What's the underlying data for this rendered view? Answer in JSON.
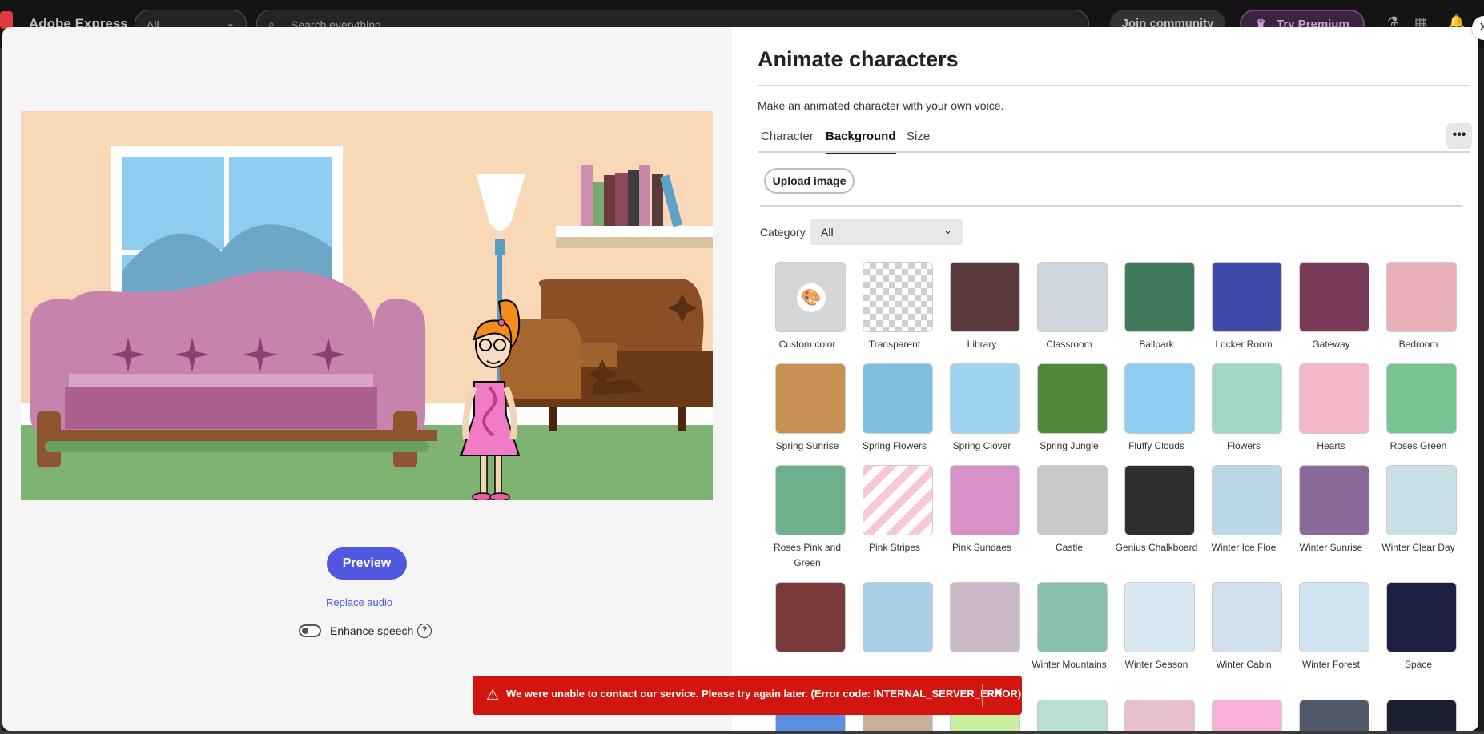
{
  "app": {
    "brand": "Adobe Express",
    "scope_value": "All",
    "search_placeholder": "Search everything",
    "join_label": "Join community",
    "premium_label": "Try Premium"
  },
  "panel": {
    "title": "Animate characters",
    "subtitle": "Make an animated character with your own voice.",
    "tabs": [
      {
        "label": "Character",
        "active": false
      },
      {
        "label": "Background",
        "active": true
      },
      {
        "label": "Size",
        "active": false
      }
    ],
    "more_label": "•••",
    "upload_label": "Upload image",
    "category_label": "Category",
    "category_value": "All",
    "tiles": [
      {
        "label": "Custom color"
      },
      {
        "label": "Transparent"
      },
      {
        "label": "Library"
      },
      {
        "label": "Classroom"
      },
      {
        "label": "Ballpark"
      },
      {
        "label": "Locker Room"
      },
      {
        "label": "Gateway"
      },
      {
        "label": "Bedroom"
      },
      {
        "label": "Spring Sunrise"
      },
      {
        "label": "Spring Flowers"
      },
      {
        "label": "Spring Clover"
      },
      {
        "label": "Spring Jungle"
      },
      {
        "label": "Fluffy Clouds"
      },
      {
        "label": "Flowers"
      },
      {
        "label": "Hearts"
      },
      {
        "label": "Roses Green"
      },
      {
        "label": "Roses Pink and Green"
      },
      {
        "label": "Pink Stripes"
      },
      {
        "label": "Pink Sundaes"
      },
      {
        "label": "Castle"
      },
      {
        "label": "Genius Chalkboard"
      },
      {
        "label": "Winter Ice Floe"
      },
      {
        "label": "Winter Sunrise"
      },
      {
        "label": "Winter Clear Day"
      },
      {
        "label": ""
      },
      {
        "label": ""
      },
      {
        "label": ""
      },
      {
        "label": "Winter Mountains"
      },
      {
        "label": "Winter Season"
      },
      {
        "label": "Winter Cabin"
      },
      {
        "label": "Winter Forest"
      },
      {
        "label": "Space"
      },
      {
        "label": ""
      },
      {
        "label": ""
      },
      {
        "label": ""
      },
      {
        "label": ""
      },
      {
        "label": ""
      },
      {
        "label": ""
      },
      {
        "label": ""
      },
      {
        "label": ""
      }
    ],
    "tile_colors": [
      "#d6d6d6",
      "checker",
      "#5a3a3a",
      "#cfd6de",
      "#3f7a5a",
      "#3f4aa8",
      "#7a3a5a",
      "#e9b0b8",
      "#c89050",
      "#7fbfe0",
      "#9fd3f0",
      "#4f8a3a",
      "#8fcdf0",
      "#a0d8c8",
      "#f5b8c8",
      "#78c490",
      "#6fb08a",
      "stripes",
      "#d890c8",
      "#c8c8c8",
      "#2e2e2e",
      "#bcd8e8",
      "#8a6a9a",
      "#c8dfe8",
      "#7a3a3a",
      "#a8d0e8",
      "#c8b8c8",
      "#88c0b0",
      "#d8e8f0",
      "#cfe0ec",
      "#d0e4f0",
      "#1c2044",
      "#5a90e0",
      "#c8b098",
      "#c8f0a0",
      "#b8e0d0",
      "#e8c0d0",
      "#f8b0d8",
      "#505a68",
      "#1a2030"
    ]
  },
  "stage": {
    "preview_label": "Preview",
    "replace_audio_label": "Replace audio",
    "enhance_label": "Enhance speech",
    "help_label": "?"
  },
  "toast": {
    "message": "We were unable to contact our service. Please try again later. (Error code: INTERNAL_SERVER_ERROR)",
    "close_label": "×"
  }
}
